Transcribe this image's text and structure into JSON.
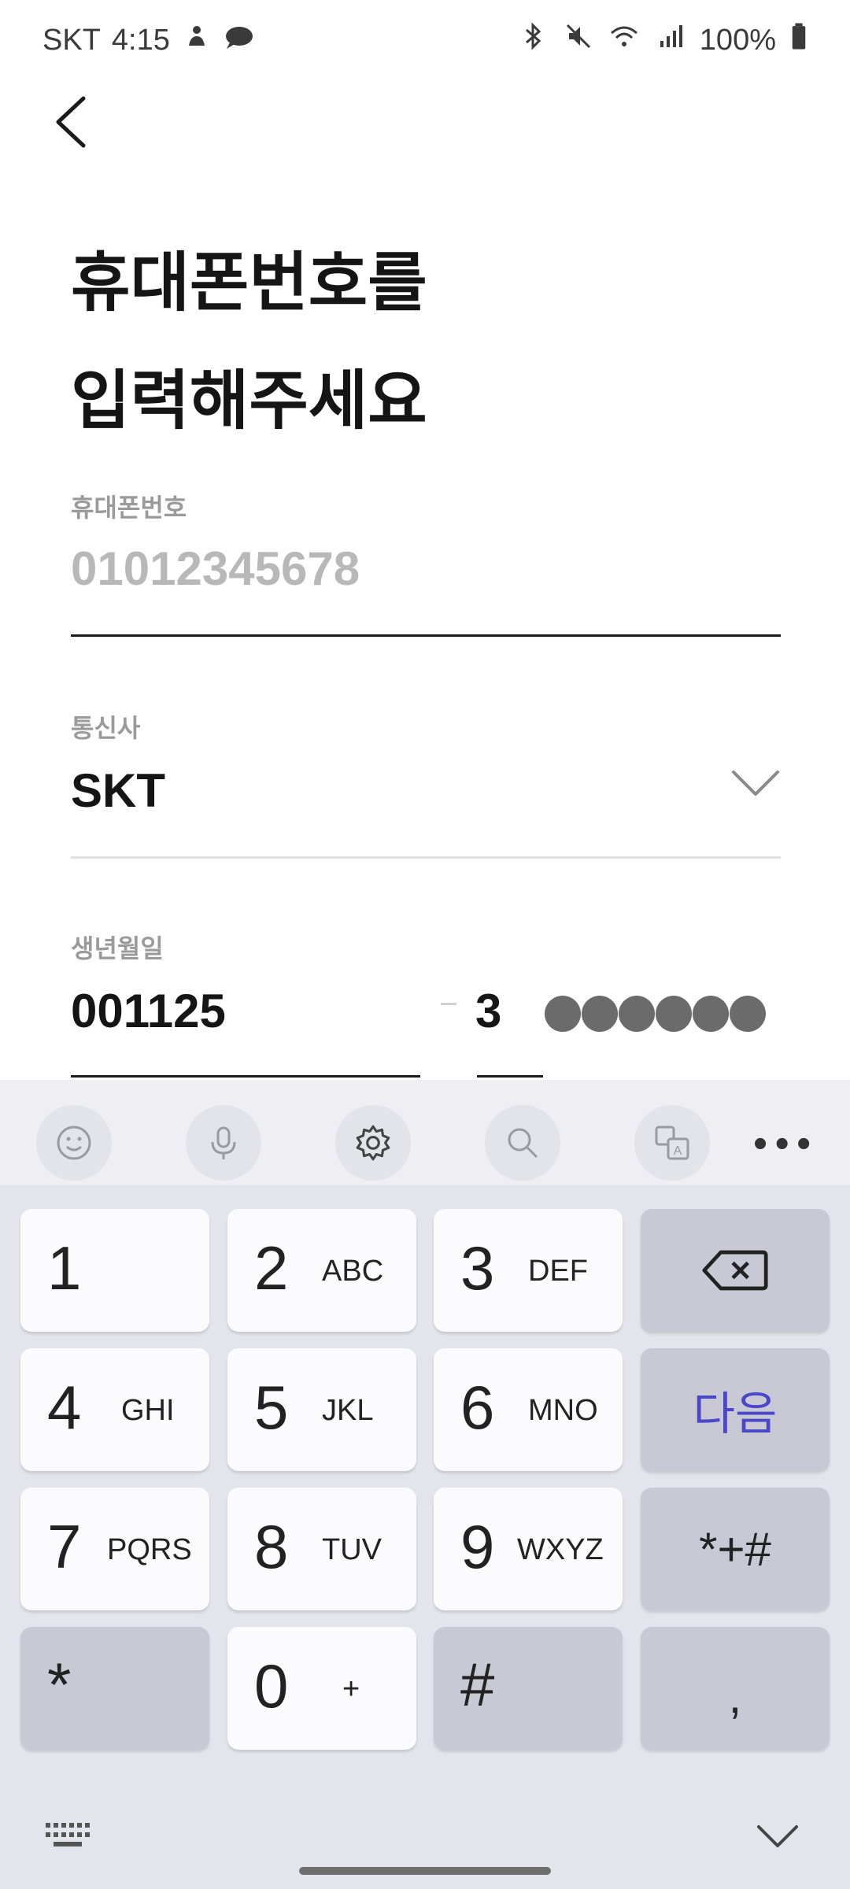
{
  "status_bar": {
    "carrier": "SKT",
    "time": "4:15",
    "battery": "100%",
    "icons": [
      "notification-icon",
      "cloud-chat-icon",
      "bluetooth-icon",
      "mute-icon",
      "wifi-icon",
      "signal-icon",
      "battery-icon"
    ]
  },
  "header": {
    "back_icon": "chevron-left-icon"
  },
  "title": {
    "line1": "휴대폰번호를",
    "line2": "입력해주세요"
  },
  "phone_field": {
    "label": "휴대폰번호",
    "placeholder": "01012345678",
    "value": ""
  },
  "carrier_field": {
    "label": "통신사",
    "value": "SKT",
    "dropdown_icon": "chevron-down-icon"
  },
  "birth_field": {
    "label": "생년월일",
    "value": "001125",
    "gender_digit": "3",
    "masked_count": 6
  },
  "keyboard": {
    "toolbar": [
      "emoji-icon",
      "mic-icon",
      "settings-icon",
      "search-icon",
      "translate-icon",
      "more-icon"
    ],
    "more_label": "•••",
    "keys": [
      {
        "num": "1",
        "letters": ""
      },
      {
        "num": "2",
        "letters": "ABC"
      },
      {
        "num": "3",
        "letters": "DEF"
      },
      {
        "num": "4",
        "letters": "GHI"
      },
      {
        "num": "5",
        "letters": "JKL"
      },
      {
        "num": "6",
        "letters": "MNO"
      },
      {
        "num": "7",
        "letters": "PQRS"
      },
      {
        "num": "8",
        "letters": "TUV"
      },
      {
        "num": "9",
        "letters": "WXYZ"
      },
      {
        "num": "0",
        "letters": "+"
      }
    ],
    "next_label": "다음",
    "symbols_label": "*+#",
    "star_label": "*",
    "hash_label": "#",
    "comma_label": ","
  },
  "colors": {
    "accent": "#4a47c9",
    "placeholder": "#b8b8b8",
    "label": "#9a9a9a"
  }
}
